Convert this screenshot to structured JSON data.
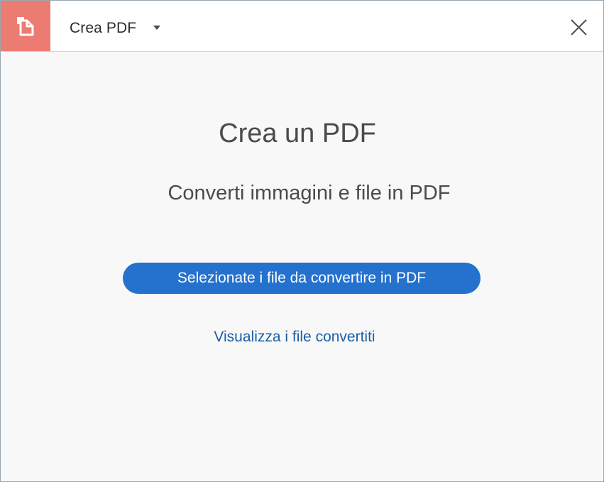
{
  "header": {
    "tool_title": "Crea PDF",
    "app_icon": "create-pdf-icon",
    "dropdown_icon": "caret-down-icon",
    "close_icon": "close-icon"
  },
  "main": {
    "heading": "Crea un PDF",
    "subheading": "Converti immagini e file in PDF",
    "primary_button_label": "Selezionate i file da convertire in PDF",
    "link_label": "Visualizza i file convertiti"
  },
  "colors": {
    "brand_tile": "#ec7c72",
    "primary_button": "#2472cd",
    "link": "#1a5fa7",
    "background": "#f8f8f8"
  }
}
